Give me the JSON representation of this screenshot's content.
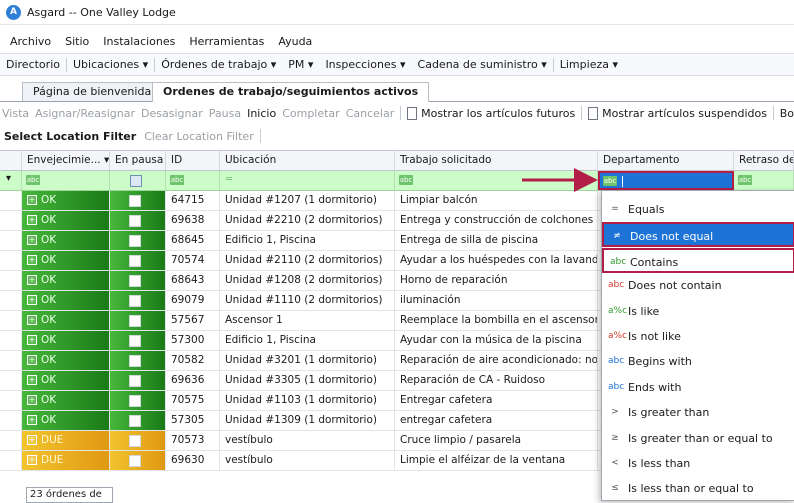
{
  "window": {
    "title": "Asgard -- One Valley Lodge"
  },
  "menu": [
    "Archivo",
    "Sitio",
    "Instalaciones",
    "Herramientas",
    "Ayuda"
  ],
  "nav": [
    {
      "label": "Directorio",
      "dropdown": false
    },
    {
      "label": "Ubicaciones",
      "dropdown": true
    },
    {
      "label": "Órdenes de trabajo",
      "dropdown": true
    },
    {
      "label": "PM",
      "dropdown": true
    },
    {
      "label": "Inspecciones",
      "dropdown": true
    },
    {
      "label": "Cadena de suministro",
      "dropdown": true
    },
    {
      "label": "Limpieza",
      "dropdown": true
    }
  ],
  "tabs": [
    {
      "label": "Página de bienvenida",
      "active": false
    },
    {
      "label": "Ordenes de trabajo/seguimientos activos",
      "active": true
    }
  ],
  "toolbar": {
    "view": "Vista",
    "assign": "Asignar/Reasignar",
    "unassign": "Desasignar",
    "pause": "Pausa",
    "start": "Inicio",
    "complete": "Completar",
    "cancel": "Cancelar",
    "show_future": "Mostrar los artículos futuros",
    "show_suspended": "Mostrar artículos suspendidos",
    "cut": "Bo"
  },
  "filterbar": {
    "select": "Select Location Filter",
    "clear": "Clear Location Filter"
  },
  "columns": [
    "Envejecimie...",
    "En pausa",
    "ID",
    "Ubicación",
    "Trabajo solicitado",
    "Departamento",
    "Retraso de r"
  ],
  "rows": [
    {
      "aging": "OK",
      "id": "64715",
      "location": "Unidad #1207 (1 dormitorio)",
      "work": "Limpiar balcón"
    },
    {
      "aging": "OK",
      "id": "69638",
      "location": "Unidad #2210 (2 dormitorios)",
      "work": "Entrega y construcción de colchones de..."
    },
    {
      "aging": "OK",
      "id": "68645",
      "location": "Edificio 1, Piscina",
      "work": "Entrega de silla de piscina"
    },
    {
      "aging": "OK",
      "id": "70574",
      "location": "Unidad #2110 (2 dormitorios)",
      "work": "Ayudar a los huéspedes con la lavandería"
    },
    {
      "aging": "OK",
      "id": "68643",
      "location": "Unidad #1208 (2 dormitorios)",
      "work": "Horno de reparación"
    },
    {
      "aging": "OK",
      "id": "69079",
      "location": "Unidad #1110 (2 dormitorios)",
      "work": "iluminación"
    },
    {
      "aging": "OK",
      "id": "57567",
      "location": "Ascensor 1",
      "work": "Reemplace la bombilla en el ascensor"
    },
    {
      "aging": "OK",
      "id": "57300",
      "location": "Edificio 1, Piscina",
      "work": "Ayudar con la música de la piscina"
    },
    {
      "aging": "OK",
      "id": "70582",
      "location": "Unidad #3201 (1 dormitorio)",
      "work": "Reparación de aire acondicionado: no f..."
    },
    {
      "aging": "OK",
      "id": "69636",
      "location": "Unidad #3305 (1 dormitorio)",
      "work": "Reparación de CA - Ruidoso"
    },
    {
      "aging": "OK",
      "id": "70575",
      "location": "Unidad #1103 (1 dormitorio)",
      "work": "Entregar cafetera"
    },
    {
      "aging": "OK",
      "id": "57305",
      "location": "Unidad #1309 (1 dormitorio)",
      "work": "entregar cafetera"
    },
    {
      "aging": "DUE",
      "id": "70573",
      "location": "vestíbulo",
      "work": "Cruce limpio / pasarela"
    },
    {
      "aging": "DUE",
      "id": "69630",
      "location": "vestíbulo",
      "work": "Limpie el alféizar de la ventana"
    }
  ],
  "filter_menu": [
    {
      "icon": "=",
      "label": "Equals",
      "state": ""
    },
    {
      "icon": "≠",
      "label": "Does not equal",
      "state": "selected"
    },
    {
      "icon": "abc",
      "label": "Contains",
      "state": "outlined"
    },
    {
      "icon": "abc",
      "label": "Does not contain",
      "state": ""
    },
    {
      "icon": "a%c",
      "label": "Is like",
      "state": ""
    },
    {
      "icon": "a%c",
      "label": "Is not like",
      "state": ""
    },
    {
      "icon": "abc",
      "label": "Begins with",
      "state": ""
    },
    {
      "icon": "abc",
      "label": "Ends with",
      "state": ""
    },
    {
      "icon": ">",
      "label": "Is greater than",
      "state": ""
    },
    {
      "icon": "≥",
      "label": "Is greater than or equal to",
      "state": ""
    },
    {
      "icon": "<",
      "label": "Is less than",
      "state": ""
    },
    {
      "icon": "≤",
      "label": "Is less than or equal to",
      "state": ""
    }
  ],
  "status": {
    "count": "23 órdenes de"
  },
  "colors": {
    "ok_green": "#1f8a1a",
    "due_orange": "#e8a51a",
    "filter_row": "#ccfcc8",
    "selection": "#1e74d6",
    "annotation": "#b31e49"
  }
}
